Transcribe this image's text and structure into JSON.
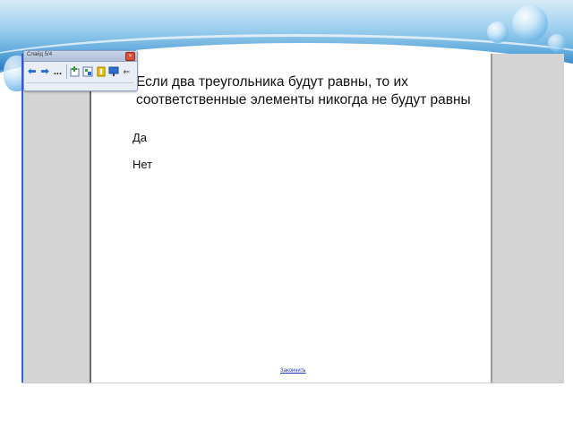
{
  "question": {
    "line1": "Если два треугольника будут равны, то их",
    "line2": "соответственные элементы никогда не будут равны"
  },
  "answers": [
    "Да",
    "Нет"
  ],
  "footer_link": "Закончить",
  "toolbar": {
    "title": "Слайд 5/4",
    "close": "×",
    "buttons": [
      {
        "icon": "back-arrow-icon",
        "glyph": "⬅"
      },
      {
        "icon": "forward-arrow-icon",
        "glyph": "➡"
      },
      {
        "icon": "more-options-icon",
        "glyph": "..."
      },
      {
        "icon": "insert-slide-icon",
        "glyph": ""
      },
      {
        "icon": "slide-sorter-icon",
        "glyph": ""
      },
      {
        "icon": "notes-icon",
        "glyph": ""
      },
      {
        "icon": "presentation-icon",
        "glyph": ""
      },
      {
        "icon": "collapse-toolbar-icon",
        "glyph": "⇐"
      }
    ]
  },
  "colors": {
    "panel_gray": "#d4d4d4",
    "accent_blue": "#2a6fd0",
    "link_blue": "#2233cc"
  }
}
